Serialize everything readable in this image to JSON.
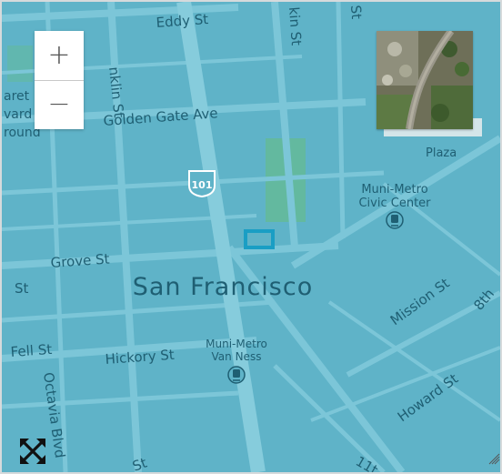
{
  "map": {
    "city_label": "San Francisco",
    "streets": {
      "eddy": "Eddy St",
      "franklin": "nklin St",
      "larkin": "kin St",
      "top_st": "St",
      "golden_gate": "Golden Gate Ave",
      "grove": "Grove St",
      "left_st": "St",
      "fell": "Fell St",
      "hickory": "Hickory St",
      "octavia": "Octavia Blvd",
      "mission": "Mission St",
      "eighth": "8th",
      "howard": "Howard St",
      "bottom_st": "St",
      "eleventh": "11t"
    },
    "places": {
      "left_fragment_1": "aret",
      "left_fragment_2": "vard",
      "left_fragment_3": "round",
      "plaza": "Plaza",
      "civic_center_1": "Muni-Metro",
      "civic_center_2": "Civic Center",
      "van_ness_1": "Muni-Metro",
      "van_ness_2": "Van Ness"
    },
    "highway_shield": "101"
  },
  "controls": {
    "zoom_in": "+",
    "zoom_out": "−"
  },
  "colors": {
    "overlay": "#5fb3c8",
    "street": "#7cc6d8",
    "park": "#63b99f",
    "label": "#1f5f73",
    "selection": "#1a9ec4"
  }
}
